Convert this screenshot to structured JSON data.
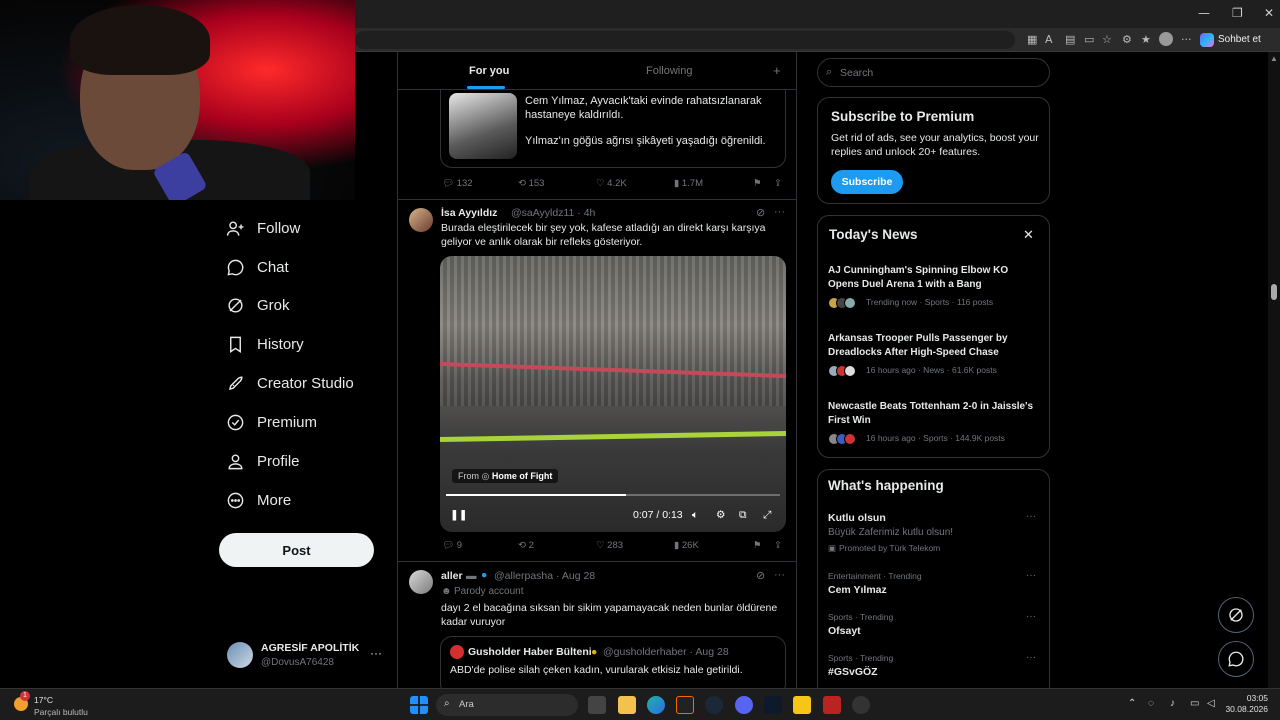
{
  "browser": {
    "window_controls": [
      "—",
      "❐",
      "✕"
    ],
    "chat_button": "Sohbet et"
  },
  "tabs": {
    "for_you": "For you",
    "following": "Following",
    "plus": "+"
  },
  "tweet1": {
    "card_text1": "Cem Yılmaz, Ayvacık'taki evinde rahatsızlanarak hastaneye kaldırıldı.",
    "card_text2": "Yılmaz'ın göğüs ağrısı şikâyeti yaşadığı öğrenildi.",
    "replies": "132",
    "reposts": "153",
    "likes": "4.2K",
    "views": "1.7M"
  },
  "tweet2": {
    "name": "İsa Ayyıldız",
    "handle": "@saAyyldz11 · 4h",
    "text": "Burada eleştirilecek bir şey yok, kafese atladığı an direkt karşı karşıya geliyor ve anlık olarak bir refleks gösteriyor.",
    "video_from": "From",
    "video_source": "Home of Fight",
    "time": "0:07 / 0:13",
    "progress": 0.54,
    "replies": "9",
    "reposts": "2",
    "likes": "283",
    "views": "26K"
  },
  "tweet3": {
    "name": "aller",
    "handle": "@allerpasha · Aug 28",
    "parody": "Parody account",
    "text": "dayı 2 el bacağına sıksan bir sikim yapamayacak neden bunlar öldürene kadar vuruyor",
    "quote_name": "Gusholder Haber Bülteni",
    "quote_handle": "@gusholderhaber · Aug 28",
    "quote_text": "ABD'de polise silah çeken kadın, vurularak etkisiz hale getirildi."
  },
  "nav": {
    "follow": "Follow",
    "chat": "Chat",
    "grok": "Grok",
    "history": "History",
    "creator_studio": "Creator Studio",
    "premium": "Premium",
    "profile": "Profile",
    "more": "More",
    "post": "Post"
  },
  "account": {
    "name": "AGRESİF APOLİTİK",
    "handle": "@DovusA76428",
    "dots": "···"
  },
  "search": {
    "placeholder": "Search"
  },
  "premium": {
    "title": "Subscribe to Premium",
    "text": "Get rid of ads, see your analytics, boost your replies and unlock 20+ features.",
    "button": "Subscribe"
  },
  "news": {
    "title": "Today's News",
    "items": [
      {
        "title": "AJ Cunningham's Spinning Elbow KO Opens Duel Arena 1 with a Bang",
        "meta": "Trending now · Sports · 116 posts"
      },
      {
        "title": "Arkansas Trooper Pulls Passenger by Dreadlocks After High-Speed Chase",
        "meta": "16 hours ago · News · 61.6K posts"
      },
      {
        "title": "Newcastle Beats Tottenham 2-0 in Jaissle's First Win",
        "meta": "16 hours ago · Sports · 144.9K posts"
      }
    ]
  },
  "happening": {
    "title": "What's happening",
    "promo": {
      "name": "Kutlu olsun",
      "desc": "Büyük Zaferimiz kutlu olsun!",
      "promoted": "Promoted by Türk Telekom"
    },
    "trends": [
      {
        "cat": "Entertainment · Trending",
        "name": "Cem Yılmaz"
      },
      {
        "cat": "Sports · Trending",
        "name": "Ofsayt"
      },
      {
        "cat": "Sports · Trending",
        "name": "#GSvGÖZ"
      }
    ]
  },
  "taskbar": {
    "weather_badge": "1",
    "temp": "17°C",
    "condition": "Parçalı bulutlu",
    "search": "Ara",
    "time": "03:05",
    "date": "30.08.2026"
  }
}
